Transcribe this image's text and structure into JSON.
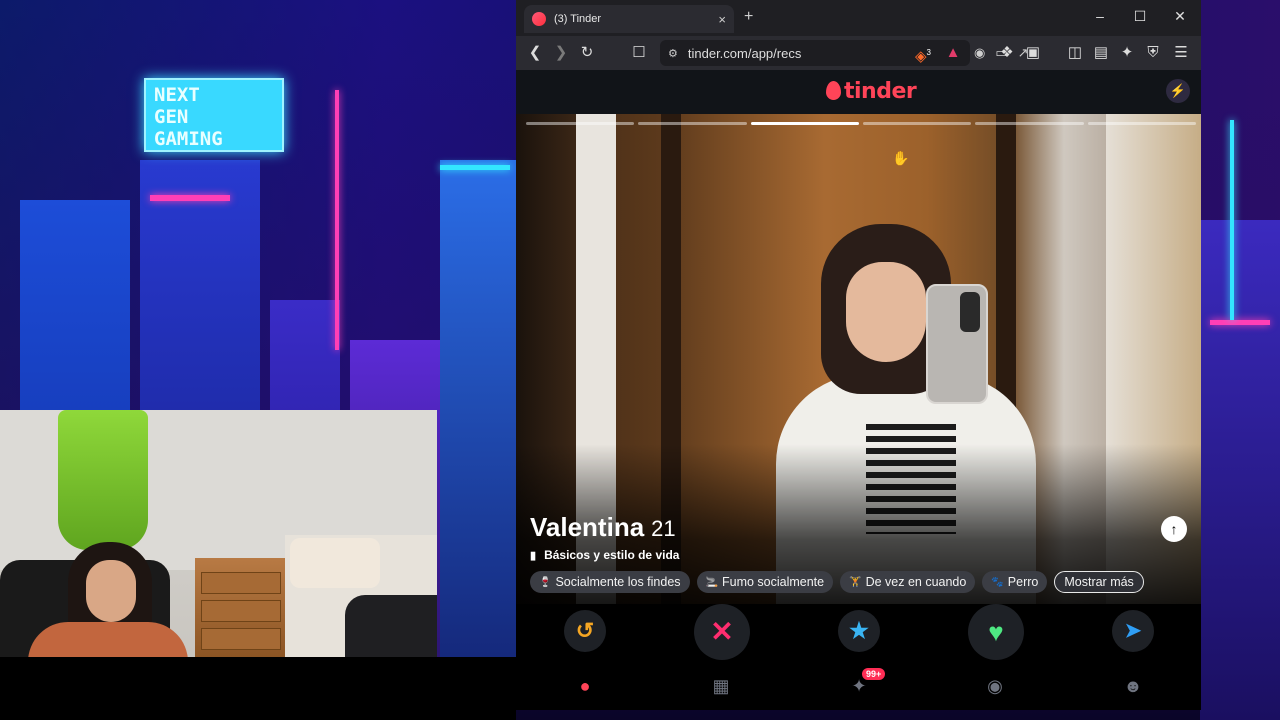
{
  "wallpaper": {
    "sign_lines": [
      "NEXT",
      "GEN",
      "GAMING"
    ]
  },
  "browser": {
    "tab_title": "(3) Tinder",
    "tab_close": "×",
    "new_tab": "+",
    "window_controls": [
      "–",
      "☐",
      "✕"
    ],
    "url": "tinder.com/app/recs",
    "brave_badge": "3"
  },
  "tinder": {
    "logo_text": "tinder",
    "photo_count": 6,
    "active_photo": 3,
    "profile": {
      "name": "Valentina",
      "age": "21",
      "section_label": "Básicos y estilo de vida",
      "chips": [
        {
          "icon": "wine-glass-icon",
          "glyph": "🍷",
          "label": "Socialmente los findes"
        },
        {
          "icon": "smoking-icon",
          "glyph": "🚬",
          "label": "Fumo socialmente"
        },
        {
          "icon": "dumbbell-icon",
          "glyph": "🏋",
          "label": "De vez en cuando"
        },
        {
          "icon": "paw-icon",
          "glyph": "🐾",
          "label": "Perro"
        }
      ],
      "more_label": "Mostrar más"
    },
    "nav_badge": "99+"
  },
  "colors": {
    "brand": "#ff4458",
    "rewind": "#f5a623",
    "nope": "#ff2d6f",
    "super_like": "#3ab4f2",
    "like": "#4ee882",
    "boost": "#2f9ef5"
  }
}
